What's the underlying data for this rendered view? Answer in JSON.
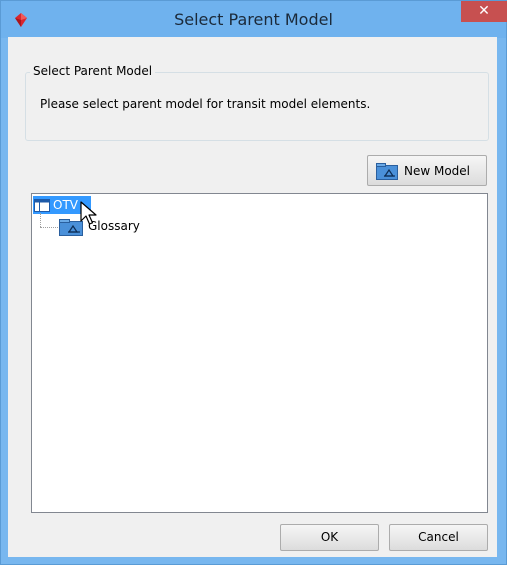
{
  "window": {
    "title": "Select Parent Model",
    "close_label": "✕"
  },
  "group": {
    "legend": "Select Parent Model",
    "message": "Please select parent model for transit model elements."
  },
  "toolbar": {
    "new_model_label": "New Model"
  },
  "tree": {
    "root": {
      "label": "OTV",
      "selected": true
    },
    "children": [
      {
        "label": "Glossary"
      }
    ]
  },
  "footer": {
    "ok_label": "OK",
    "cancel_label": "Cancel"
  },
  "icons": {
    "app": "app-logo-icon",
    "new_model": "model-package-icon",
    "root": "project-icon",
    "child": "model-package-icon",
    "cursor": "mouse-pointer-icon"
  },
  "colors": {
    "titlebar": "#6fb2ee",
    "close_button": "#c75050",
    "selection": "#3399ff",
    "dialog_bg": "#f0f0f0"
  }
}
